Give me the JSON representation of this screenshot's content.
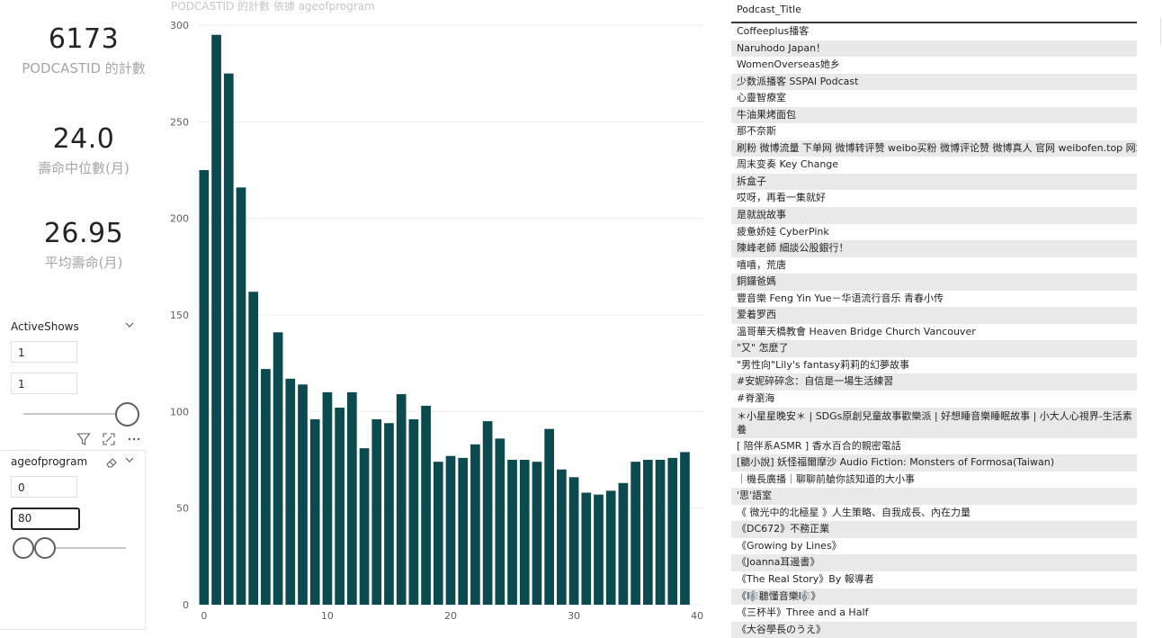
{
  "kpis": [
    {
      "value": "6173",
      "label": "PODCASTID 的計數"
    },
    {
      "value": "24.0",
      "label": "壽命中位數(月)"
    },
    {
      "value": "26.95",
      "label": "平均壽命(月)"
    }
  ],
  "slicer_active": {
    "title": "ActiveShows",
    "min": "1",
    "max": "1",
    "slider_value": 1
  },
  "slicer_age": {
    "title": "ageofprogram",
    "min": "0",
    "max": "80",
    "slider_range": [
      0,
      80
    ]
  },
  "chart_data": {
    "type": "bar",
    "title": "PODCASTID 的計數 依據 ageofprogram",
    "x": [
      0,
      1,
      2,
      3,
      4,
      5,
      6,
      7,
      8,
      9,
      10,
      11,
      12,
      13,
      14,
      15,
      16,
      17,
      18,
      19,
      20,
      21,
      22,
      23,
      24,
      25,
      26,
      27,
      28,
      29,
      30,
      31,
      32,
      33,
      34,
      35,
      36,
      37,
      38,
      39
    ],
    "values": [
      225,
      295,
      275,
      216,
      162,
      122,
      141,
      117,
      114,
      96,
      110,
      102,
      110,
      81,
      96,
      94,
      109,
      96,
      103,
      74,
      77,
      76,
      83,
      95,
      86,
      75,
      75,
      74,
      91,
      70,
      66,
      58,
      57,
      59,
      63,
      74,
      75,
      75,
      76,
      79
    ],
    "ylim": [
      0,
      300
    ],
    "yticks": [
      0,
      50,
      100,
      150,
      200,
      250,
      300
    ],
    "xticks": [
      0,
      10,
      20,
      30,
      40
    ],
    "bar_color": "#0b4a4f",
    "grid": true
  },
  "table": {
    "header": "Podcast_Title",
    "rows": [
      "Coffeeplus播客",
      "Naruhodo Japan！",
      "WomenOverseas她乡",
      "少数派播客 SSPAI Podcast",
      "心靈智療室",
      "牛油果烤面包",
      "那不奈斯",
      "刷粉 微博流量 下单网 微博转评赞 weibo买粉 微博评论赞 微博真人 官网 weibofen.top 网站",
      "周末变奏 Key Change",
      "拆盒子",
      "哎呀，再看一集就好",
      "是就說故事",
      "疲惫娇娃 CyberPink",
      "陳峰老師 細談公股銀行！",
      "嘻嘻，荒唐",
      "銅鑼爸媽",
      "豐音樂 Feng Yin Yue－华语流行音乐 青春小传",
      "爱着罗西",
      " 溫哥華天橋教會 Heaven Bridge Church Vancouver",
      "\"又\" 怎麼了",
      "\"男性向\"Lily's fantasy莉莉的幻夢故事",
      "#安妮碎碎念：自信是一場生活練習",
      "#脊瀏海",
      "＊小星星晚安＊ | SDGs原創兒童故事歡樂派 | 好想睡音樂睡眠故事 | 小大人心視界-生活素養",
      "[ 陪伴系ASMR ] 香水百合的親密電話",
      "[聽小說] 妖怪福爾摩沙 Audio Fiction: Monsters of Formosa(Taiwan)",
      "｜機長廣播｜聊聊前艙你該知道的大小事",
      "'思'語室",
      "《 微光中的北極星 》人生策略、自我成長、內在力量",
      "《DC672》不務正業",
      "《Growing by Lines》",
      "《Joanna耳邊書》",
      "《The Real Story》By 報導者",
      "《🎼聽懂音樂🎼》",
      "《三杯半》Three and a Half",
      "《大谷學長のうえ》"
    ]
  }
}
